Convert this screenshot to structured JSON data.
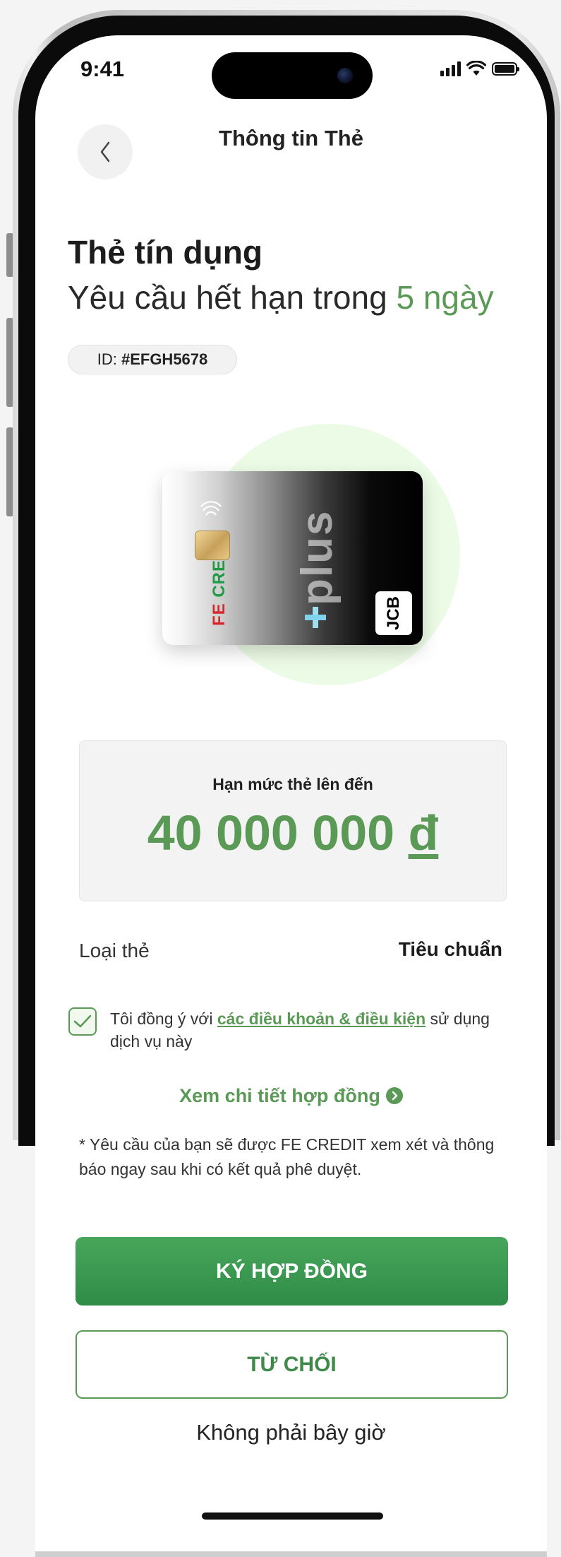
{
  "status_bar": {
    "time": "9:41"
  },
  "header": {
    "title": "Thông tin Thẻ"
  },
  "card_info": {
    "type_title": "Thẻ tín dụng",
    "expiry_prefix": "Yêu cầu hết hạn trong ",
    "expiry_days": "5 ngày",
    "id_label": "ID: ",
    "id_value": "#EFGH5678"
  },
  "card_image": {
    "brand_fe": "FE",
    "brand_credit": "CREDIT",
    "product_word": "plus",
    "network": "JCB"
  },
  "limit": {
    "label": "Hạn mức thẻ lên đến",
    "amount": "40 000 000",
    "currency": "đ"
  },
  "card_class": {
    "label": "Loại thẻ",
    "value": "Tiêu chuẩn"
  },
  "consent": {
    "checked": true,
    "prefix": "Tôi đồng ý với ",
    "link": "các điều khoản & điều kiện",
    "suffix": " sử dụng dịch vụ này"
  },
  "contract_link": {
    "label": "Xem chi tiết hợp đồng"
  },
  "note": "* Yêu cầu của bạn sẽ được FE CREDIT xem xét và thông báo ngay sau khi có kết quả phê duyệt.",
  "actions": {
    "sign": "KÝ HỢP ĐỒNG",
    "reject": "TỪ CHỐI",
    "not_now": "Không phải bây giờ"
  },
  "colors": {
    "accent": "#5a9a56",
    "button_green": "#3a9a50",
    "brand_red": "#d8262d"
  },
  "icons": {
    "back": "chevron-left-icon",
    "checkbox": "check-icon",
    "contract": "chevron-right-circle-icon"
  }
}
